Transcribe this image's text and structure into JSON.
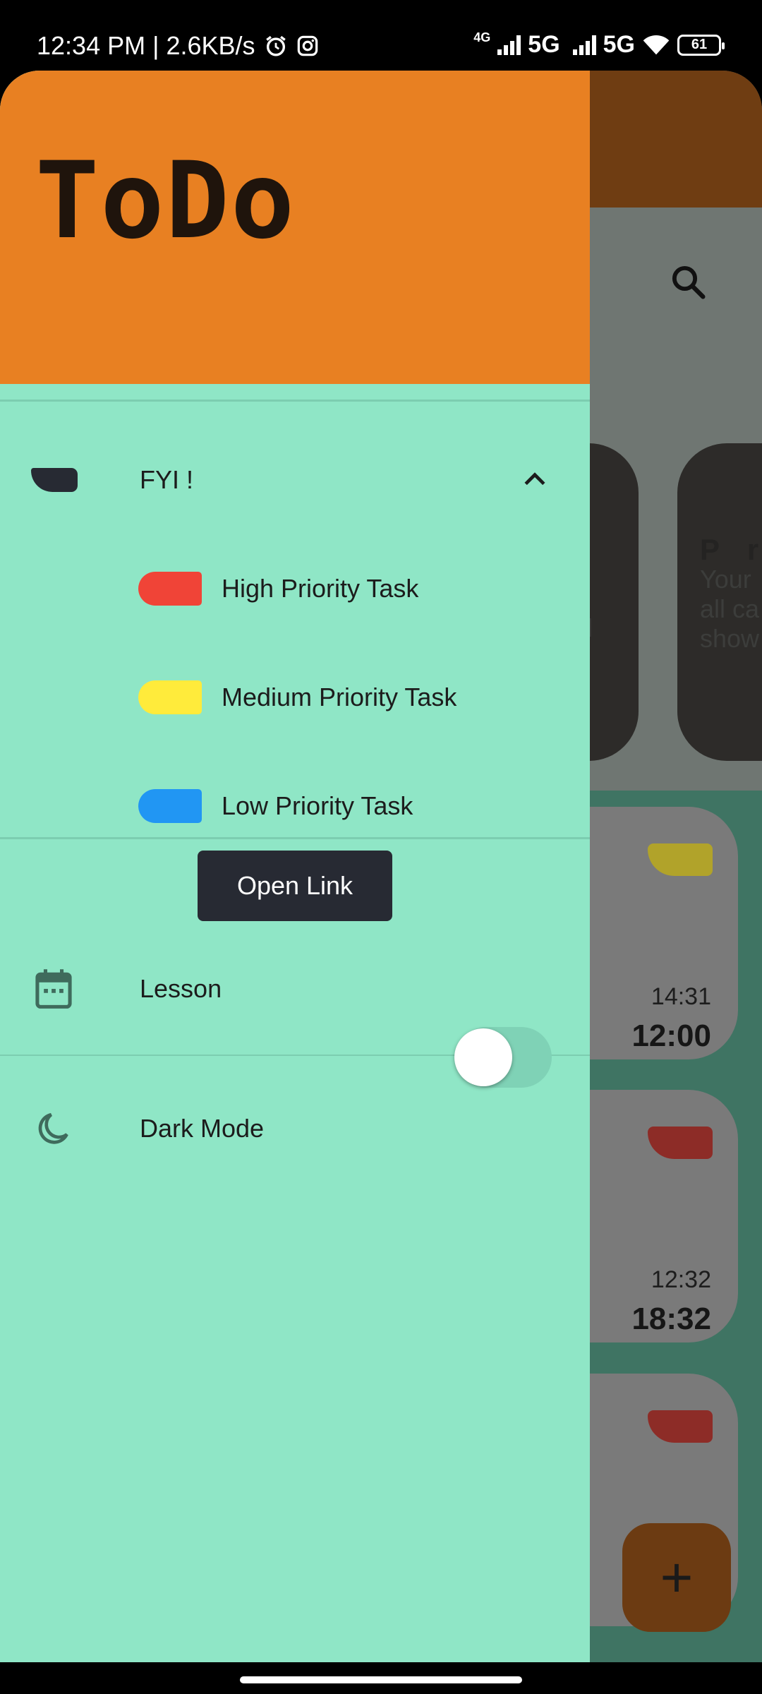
{
  "status_bar": {
    "time_speed": "12:34 PM | 2.6KB/s",
    "network_1": "4G",
    "network_label_a": "5G",
    "network_label_b": "5G",
    "battery": "61"
  },
  "app": {
    "info_card_title": "P r",
    "info_card_line1": "Your",
    "info_card_line2": "all ca",
    "info_card_line3": "show",
    "info_card_frag1": "n",
    "info_card_frag2": "ill",
    "tasks": [
      {
        "created": "14:31",
        "due": "12:00",
        "tag_color": "#b1a32a"
      },
      {
        "created": "12:32",
        "due": "18:32",
        "tag_color": "#8d2c27"
      },
      {
        "tag_color": "#8d2c27"
      }
    ],
    "fab_label": "+"
  },
  "drawer": {
    "title": "ToDo",
    "header_color": "#e88022",
    "background_color": "#8fe6c6",
    "fyi": {
      "label": "FYI !",
      "expanded": true,
      "items": [
        {
          "label": "High Priority Task",
          "color": "#f04437"
        },
        {
          "label": "Medium Priority Task",
          "color": "#ffeb3b"
        },
        {
          "label": "Low Priority Task",
          "color": "#2196f3"
        }
      ]
    },
    "open_link_label": "Open Link",
    "lesson_label": "Lesson",
    "dark_mode_label": "Dark Mode",
    "dark_mode_on": false
  }
}
